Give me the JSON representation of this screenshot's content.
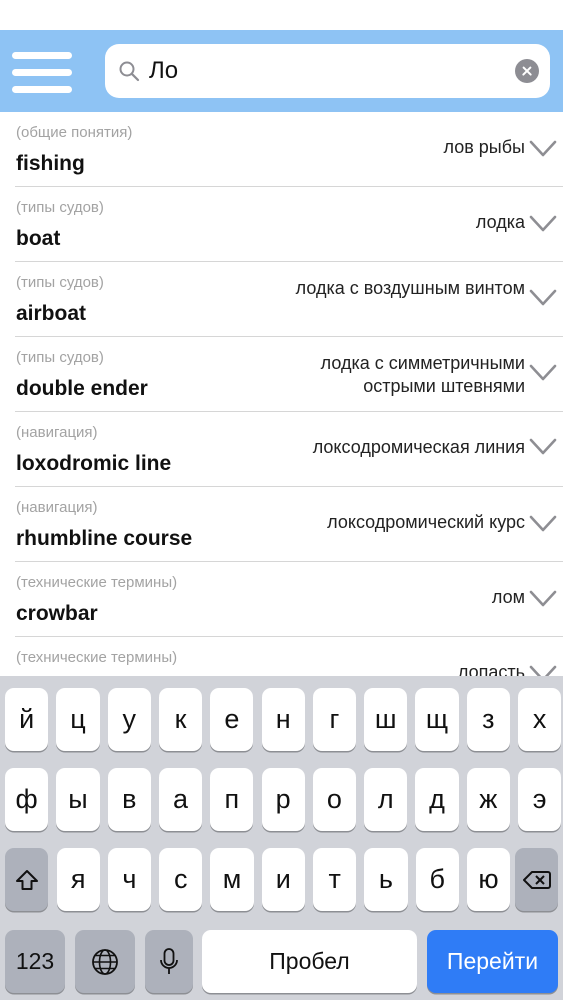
{
  "search": {
    "query": "Ло"
  },
  "results": [
    {
      "category": "(общие понятия)",
      "term": "fishing",
      "translation": "лов рыбы"
    },
    {
      "category": "(типы судов)",
      "term": "boat",
      "translation": "лодка"
    },
    {
      "category": "(типы судов)",
      "term": "airboat",
      "translation": "лодка с воздушным винтом"
    },
    {
      "category": "(типы судов)",
      "term": "double ender",
      "translation": "лодка с симметричными острыми штевнями"
    },
    {
      "category": "(навигация)",
      "term": "loxodromic line",
      "translation": "локсодромическая линия"
    },
    {
      "category": "(навигация)",
      "term": "rhumbline course",
      "translation": "локсодромический курс"
    },
    {
      "category": "(технические термины)",
      "term": "crowbar",
      "translation": "лом"
    },
    {
      "category": "(технические термины)",
      "term": "",
      "translation": "лопасть"
    }
  ],
  "keyboard": {
    "row1": [
      "й",
      "ц",
      "у",
      "к",
      "е",
      "н",
      "г",
      "ш",
      "щ",
      "з",
      "х"
    ],
    "row2": [
      "ф",
      "ы",
      "в",
      "а",
      "п",
      "р",
      "о",
      "л",
      "д",
      "ж",
      "э"
    ],
    "row3": [
      "я",
      "ч",
      "с",
      "м",
      "и",
      "т",
      "ь",
      "б",
      "ю"
    ],
    "numbers_label": "123",
    "space_label": "Пробел",
    "go_label": "Перейти"
  },
  "colors": {
    "header": "#8ec3f4",
    "go_key": "#2f7cf6",
    "keyboard_bg": "#d1d3d9"
  },
  "icons": [
    "menu-icon",
    "search-icon",
    "clear-icon",
    "chevron-down-icon",
    "shift-icon",
    "backspace-icon",
    "globe-icon",
    "microphone-icon"
  ]
}
